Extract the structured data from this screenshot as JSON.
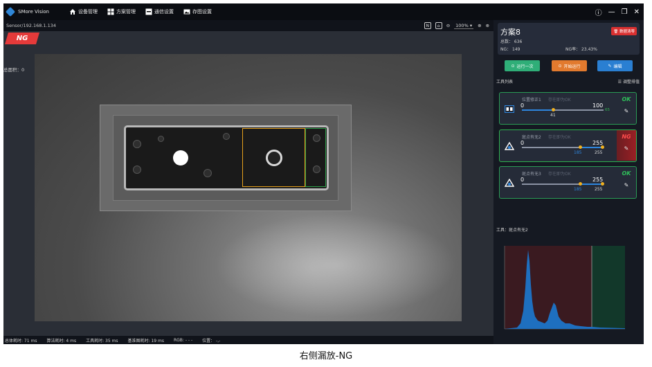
{
  "app": {
    "name": "SMore Vision",
    "menu": [
      {
        "label": "设备管理",
        "icon": "home-icon"
      },
      {
        "label": "方案管理",
        "icon": "grid-icon"
      },
      {
        "label": "通信设置",
        "icon": "monitor-icon"
      },
      {
        "label": "存图设置",
        "icon": "image-icon"
      }
    ]
  },
  "viewer": {
    "sensor": "Sensor/192.168.1.134",
    "zoom": "100%",
    "result_badge": "NG",
    "area_label": "总面积：0"
  },
  "status": {
    "total_time": "总体耗时: 71 ms",
    "algo_time": "算法耗时: 4 ms",
    "tool_time": "工具耗时: 35 ms",
    "base_time": "基准图耗时: 19 ms",
    "rgb": "RGB: - - -",
    "position": "位置： -,-"
  },
  "scheme": {
    "name": "方案8",
    "clear_label": "数据清零",
    "total": "总数：  636",
    "ng": "NG：  149",
    "ng_rate": "NG率：  23.43%"
  },
  "buttons": {
    "run_once": "运行一次",
    "start_run": "开始运行",
    "edit": "编辑"
  },
  "tool_list": {
    "title": "工具列表",
    "adjust": "调整排值",
    "tools": [
      {
        "name": "位置修正1",
        "sub": "存在即为OK",
        "min": "0",
        "max": "100",
        "current": "41",
        "extra": "65",
        "result": "OK"
      },
      {
        "name": "斑点有无2",
        "sub": "存在即为OK",
        "min": "0",
        "max": "255",
        "current": "185",
        "current2": "255",
        "result": "NG"
      },
      {
        "name": "斑点有无3",
        "sub": "存在即为OK",
        "min": "0",
        "max": "255",
        "current": "185",
        "current2": "255",
        "result": "OK"
      }
    ]
  },
  "histogram": {
    "label": "工具：斑点有无2"
  },
  "caption": "右侧漏放-NG",
  "colors": {
    "ok": "#2fbf5a",
    "ng": "#e53a3a",
    "accent": "#2e86de"
  }
}
